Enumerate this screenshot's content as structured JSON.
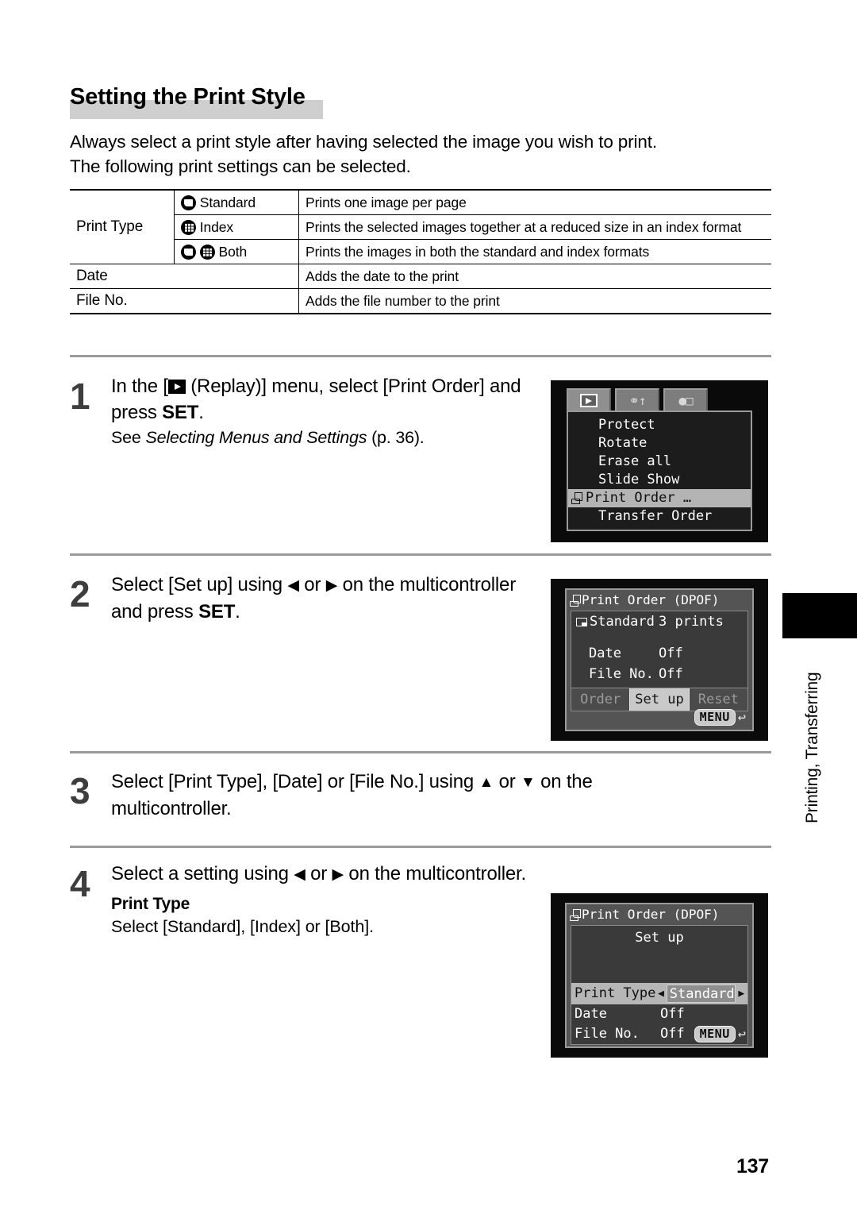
{
  "page": {
    "title": "Setting the Print Style",
    "intro_line1": "Always select a print style after having selected the image you wish to print.",
    "intro_line2": "The following print settings can be selected.",
    "page_number": "137",
    "side_tab_label": "Printing, Transferring"
  },
  "spec_table": {
    "rows": [
      {
        "row_label": "Print Type",
        "type_label": "Standard",
        "icons": [
          "standard-icon"
        ],
        "description": "Prints one image per page"
      },
      {
        "row_label": "",
        "type_label": "Index",
        "icons": [
          "index-icon"
        ],
        "description": "Prints the selected images together at a reduced size in an index format"
      },
      {
        "row_label": "",
        "type_label": "Both",
        "icons": [
          "standard-icon",
          "index-icon"
        ],
        "description": "Prints the images in both the standard and index formats"
      }
    ],
    "date_label": "Date",
    "date_desc": "Adds the date to the print",
    "fileno_label": "File No.",
    "fileno_desc": "Adds the file number to the print"
  },
  "steps": [
    {
      "number": "1",
      "text_a": "In the [",
      "text_b": " (Replay)] menu, select [Print",
      "text_c": "Order] and press ",
      "bold": "SET",
      "text_d": ".",
      "sub_a": "See ",
      "sub_b": "Selecting Menus and Settings",
      "sub_c": " (p. 36)."
    },
    {
      "number": "2",
      "line1_a": "Select [Set up] using ",
      "left_arrow": "◀",
      "mid": " or ",
      "right_arrow": "▶",
      "line1_b": " on the",
      "line2_a": "multicontroller and press ",
      "bold": "SET",
      "line2_b": "."
    },
    {
      "number": "3",
      "line1_a": "Select [Print Type], [Date] or [File No.] using ",
      "up_arrow": "▲",
      "mid": " or ",
      "down_arrow": "▼",
      "line1_b": " on the",
      "line2": "multicontroller."
    },
    {
      "number": "4",
      "line1_a": "Select a setting using ",
      "left_arrow": "◀",
      "mid": " or ",
      "right_arrow": "▶",
      "line1_b": " on the multicontroller.",
      "sub_head": "Print Type",
      "sub_text": "Select [Standard], [Index] or [Both]."
    }
  ],
  "lcd_replay_menu": {
    "tabs": [
      {
        "name": "replay-tab",
        "glyph": "",
        "active": true
      },
      {
        "name": "setup-tab",
        "glyph": "ΥΤ",
        "active": false
      },
      {
        "name": "mycamera-tab",
        "glyph": "⛃",
        "active": false
      }
    ],
    "items": [
      {
        "label": "Protect",
        "selected": false
      },
      {
        "label": "Rotate",
        "selected": false
      },
      {
        "label": "Erase all",
        "selected": false
      },
      {
        "label": "Slide Show",
        "selected": false
      },
      {
        "label": "Print Order …",
        "selected": true
      },
      {
        "label": "Transfer Order",
        "selected": false
      }
    ]
  },
  "lcd_print_order": {
    "title": "Print Order (DPOF)",
    "standard_label": "Standard",
    "standard_value": "3 prints",
    "date_label": "Date",
    "date_value": "Off",
    "fileno_label": "File No.",
    "fileno_value": "Off",
    "buttons": [
      {
        "label": "Order",
        "selected": false
      },
      {
        "label": "Set up",
        "selected": true
      },
      {
        "label": "Reset",
        "selected": false
      }
    ],
    "menu_badge": "MENU",
    "return_arrow": "↩"
  },
  "lcd_setup": {
    "title": "Print Order (DPOF)",
    "heading": "Set up",
    "print_type_label": "Print Type",
    "print_type_value": "Standard",
    "left_arrow": "◀",
    "right_arrow": "▶",
    "date_label": "Date",
    "date_value": "Off",
    "fileno_label": "File No.",
    "fileno_value": "Off",
    "menu_badge": "MENU",
    "return_arrow": "↩"
  }
}
